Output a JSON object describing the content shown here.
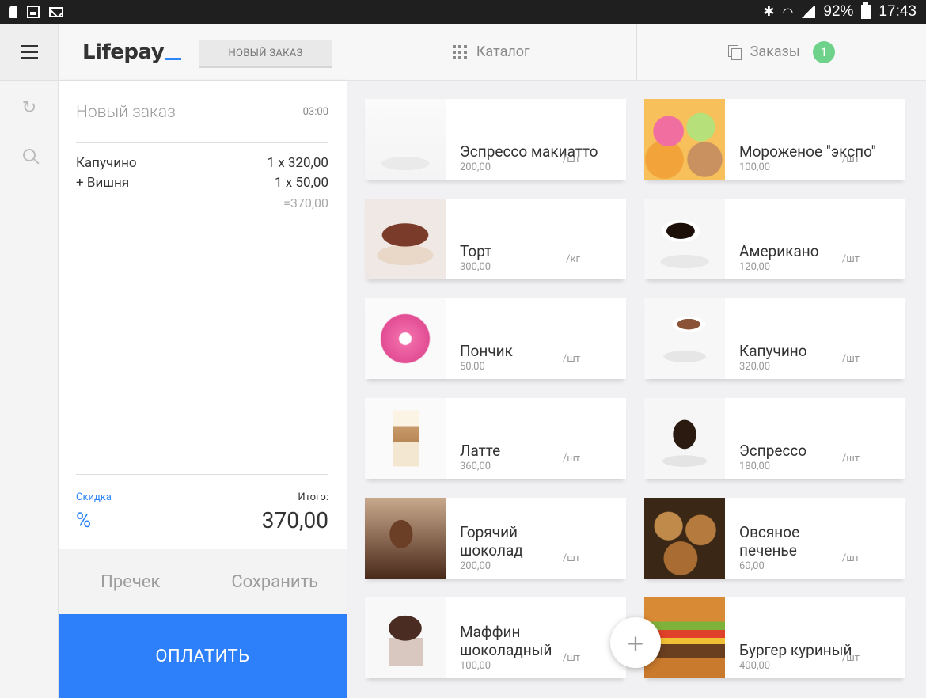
{
  "status_bar": {
    "battery": "92%",
    "time": "17:43"
  },
  "app": {
    "logo": "Lifepay",
    "new_order_button": "НОВЫЙ ЗАКАЗ"
  },
  "tabs": {
    "catalog": "Каталог",
    "orders": "Заказы",
    "orders_count": "1"
  },
  "order": {
    "title": "Новый заказ",
    "time": "03:00",
    "items": [
      {
        "name": "Капучино",
        "qty_price": "1 x 320,00"
      },
      {
        "name": "+ Вишня",
        "qty_price": "1 x 50,00"
      }
    ],
    "subtotal": "=370,00",
    "discount_label": "Скидка",
    "discount_symbol": "%",
    "total_label": "Итого:",
    "total_value": "370,00",
    "precheck_button": "Пречек",
    "save_button": "Сохранить",
    "pay_button": "ОПЛАТИТЬ"
  },
  "catalog": {
    "products": [
      {
        "name": "Эспрессо макиатто",
        "price": "200,00",
        "unit": "/шт",
        "icon": "espresso-macchiato"
      },
      {
        "name": "Мороженое \"экспо\"",
        "price": "100,00",
        "unit": "/шт",
        "icon": "icecream"
      },
      {
        "name": "Торт",
        "price": "300,00",
        "unit": "/кг",
        "icon": "cake"
      },
      {
        "name": "Американо",
        "price": "120,00",
        "unit": "/шт",
        "icon": "americano"
      },
      {
        "name": "Пончик",
        "price": "50,00",
        "unit": "/шт",
        "icon": "donut"
      },
      {
        "name": "Капучино",
        "price": "320,00",
        "unit": "/шт",
        "icon": "cappuccino"
      },
      {
        "name": "Латте",
        "price": "360,00",
        "unit": "/шт",
        "icon": "latte"
      },
      {
        "name": "Эспрессо",
        "price": "180,00",
        "unit": "/шт",
        "icon": "espresso"
      },
      {
        "name": "Горячий шоколад",
        "price": "200,00",
        "unit": "/шт",
        "icon": "hot-choc"
      },
      {
        "name": "Овсяное печенье",
        "price": "60,00",
        "unit": "/шт",
        "icon": "cookies"
      },
      {
        "name": "Маффин шоколадный",
        "price": "100,00",
        "unit": "/шт",
        "icon": "muffin"
      },
      {
        "name": "Бургер куриный",
        "price": "400,00",
        "unit": "/шт",
        "icon": "burger"
      }
    ]
  },
  "colors": {
    "accent": "#2d80fa",
    "badge": "#6fd28b"
  }
}
